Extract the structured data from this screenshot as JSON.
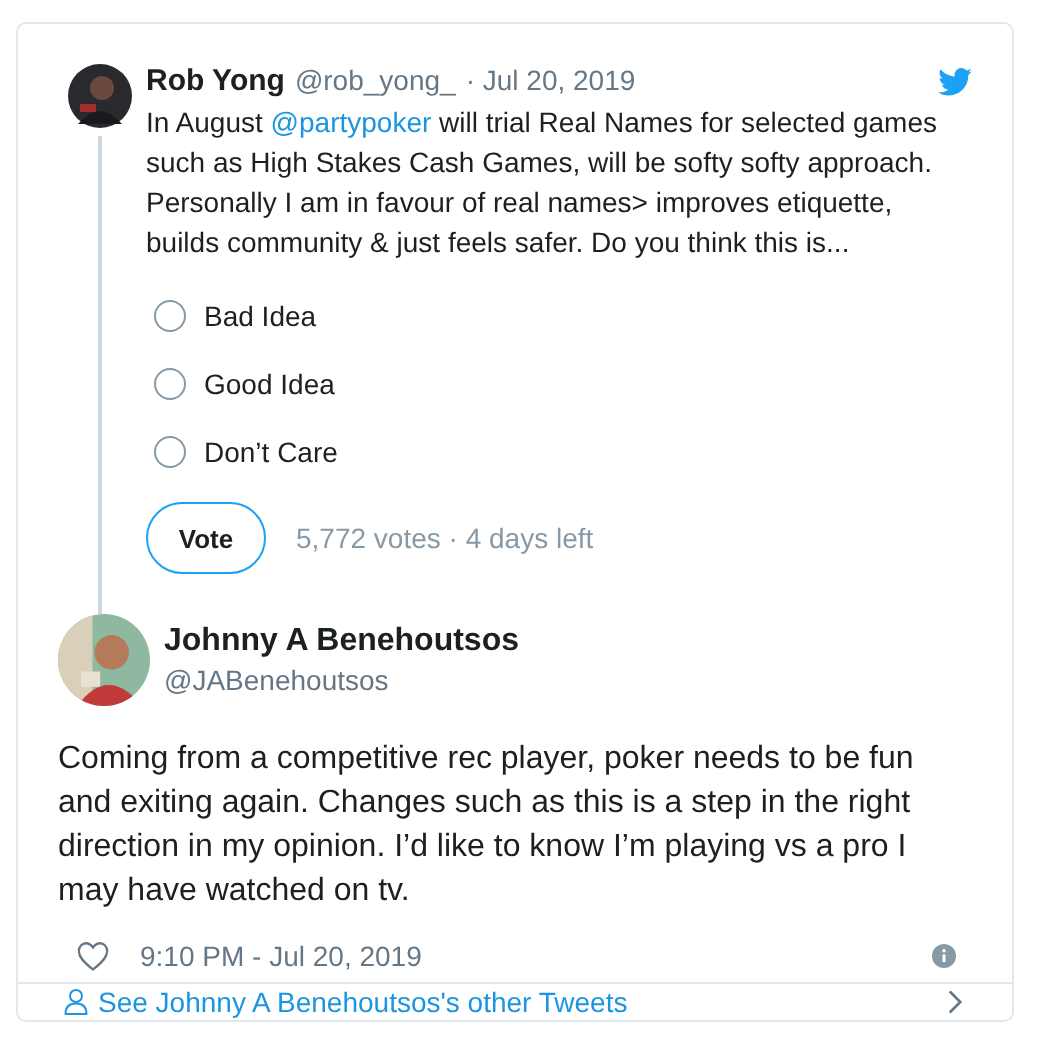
{
  "reply_to": {
    "name": "Rob Yong",
    "handle": "@rob_yong_",
    "date": "· Jul 20, 2019",
    "text_before": "In August ",
    "mention": "@partypoker",
    "text_after": " will trial Real Names for selected games such as High Stakes Cash Games, will be softy softy approach. Personally I am in favour of real names> improves etiquette, builds community & just feels safer. Do you think this is...",
    "poll": {
      "options": [
        {
          "label": "Bad Idea",
          "selected": false
        },
        {
          "label": "Good Idea",
          "selected": false
        },
        {
          "label": "Don’t Care",
          "selected": false
        }
      ],
      "button": "Vote",
      "summary": "5,772 votes · 4 days left"
    }
  },
  "tweet": {
    "name": "Johnny A Benehoutsos",
    "handle": "@JABenehoutsos",
    "text": "Coming from a competitive rec player, poker needs to be fun and exiting again. Changes such as this is a step in the right direction in my opinion. I’d like to know I’m playing vs a pro I may have watched on tv.",
    "time": "9:10 PM - Jul 20, 2019"
  },
  "footer_link": "See Johnny A Benehoutsos's other Tweets"
}
